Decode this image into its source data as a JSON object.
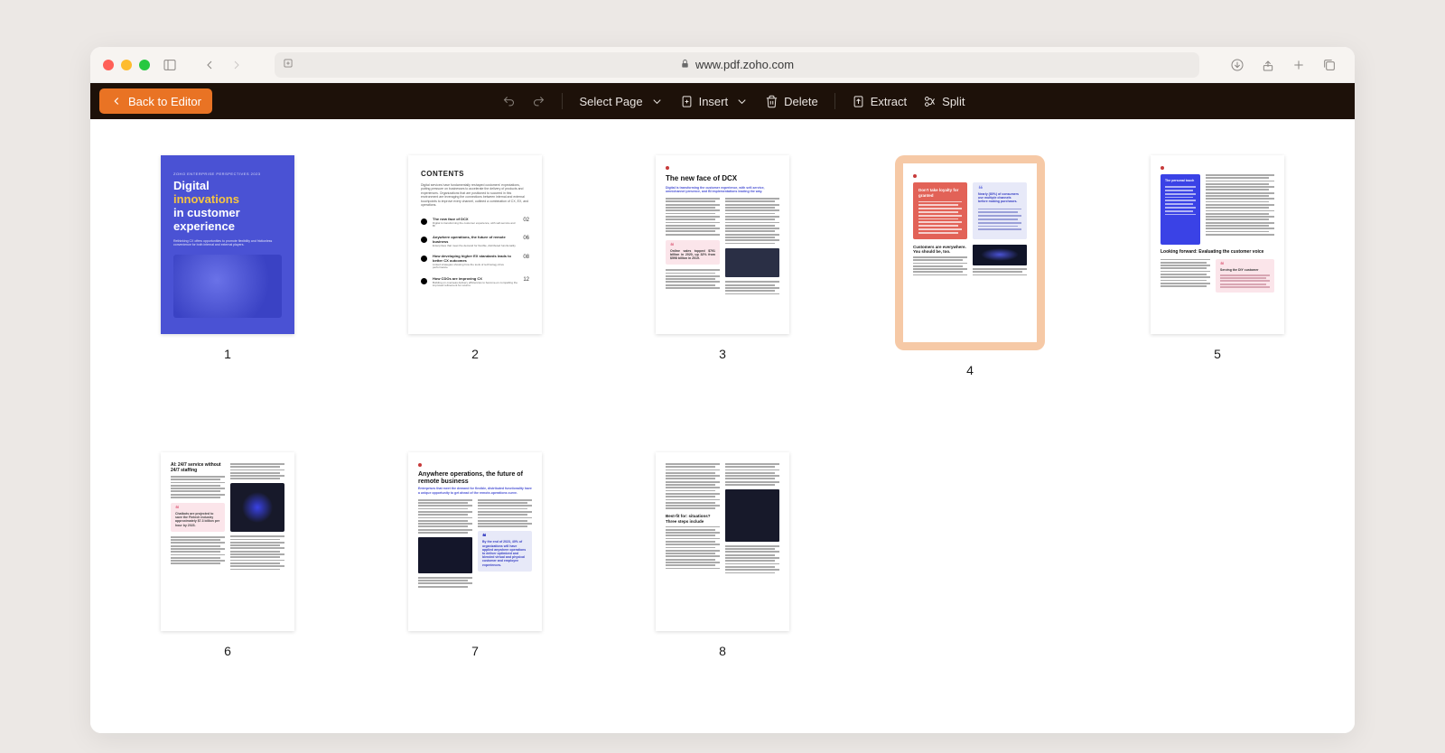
{
  "browser": {
    "url": "www.pdf.zoho.com"
  },
  "toolbar": {
    "back_to_editor": "Back to Editor",
    "select_page": "Select Page",
    "insert": "Insert",
    "delete": "Delete",
    "extract": "Extract",
    "split": "Split"
  },
  "pages": {
    "count": 8,
    "selected": 4,
    "labels": [
      "1",
      "2",
      "3",
      "4",
      "5",
      "6",
      "7",
      "8"
    ]
  },
  "thumbs": {
    "p1": {
      "tag": "ZOHO ENTERPRISE PERSPECTIVES 2023",
      "title_line1": "Digital",
      "title_line2": "innovations",
      "title_line3": "in customer",
      "title_line4": "experience",
      "sub": "Rethinking CX offers opportunities to promote flexibility and frictionless convenience for both internal and external players."
    },
    "p2": {
      "heading": "CONTENTS",
      "intro": "Digital services have fundamentally reshaped customers' expectations, putting pressure on businesses to accelerate the delivery of products and experiences. Organizations that are positioned to succeed in this environment are leveraging the connections between internal and external touchpoints to improve every channel, outlined a combination of CX, EX, and operations.",
      "items": [
        {
          "title": "The new face of DCX",
          "sub": "Digital is transforming the customer experience, with self-service and BI",
          "num": "02"
        },
        {
          "title": "Anywhere operations, the future of remote business",
          "sub": "Enterprises that meet the demand for flexible, distributed functionality",
          "num": "06"
        },
        {
          "title": "How developing higher EX standards leads to better CX outcomes",
          "sub": "Linked strategies showing how the tools of technology drive performance",
          "num": "08"
        },
        {
          "title": "How CDOs are improving CX",
          "sub": "Building on overseas delivery efficiencies to become-on compelling the improved refinement for returns",
          "num": "12"
        }
      ]
    },
    "p3": {
      "title": "The new face of DCX",
      "lede": "Digital is transforming the customer experience, with self-service, omnichannel presence, and BI implementations leading the way.",
      "pull": "Online sales topped $791 billion in 2020, up 32% from $598 billion in 2019."
    },
    "p4": {
      "red_title": "Don't take loyalty for granted",
      "blue_quote": "Nearly (80%) of consumers use multiple channels before making purchases.",
      "below_title": "Customers are everywhere. You should be, too."
    },
    "p5": {
      "blue_title": "The personal touch",
      "heading": "Looking forward: Evaluating the customer voice",
      "pink_quote": "Serving the DIY customer"
    },
    "p6": {
      "title": "AI: 24/7 service without 24/7 staffing",
      "pink": "Chatbots are projected to save the Fintech industry approximately $7.3 billion per hour by 2023."
    },
    "p7": {
      "title": "Anywhere operations, the future of remote business",
      "lede": "Enterprises that meet the demand for flexible, distributed functionality have a unique opportunity to get ahead of the remote-operations curve.",
      "quote": "By the end of 2023, 40% of organizations will have applied anywhere operations to deliver optimized and blended virtual and physical customer and employee experiences."
    },
    "p8": {
      "heading": "Best-fit for: situations? Three steps include"
    }
  }
}
